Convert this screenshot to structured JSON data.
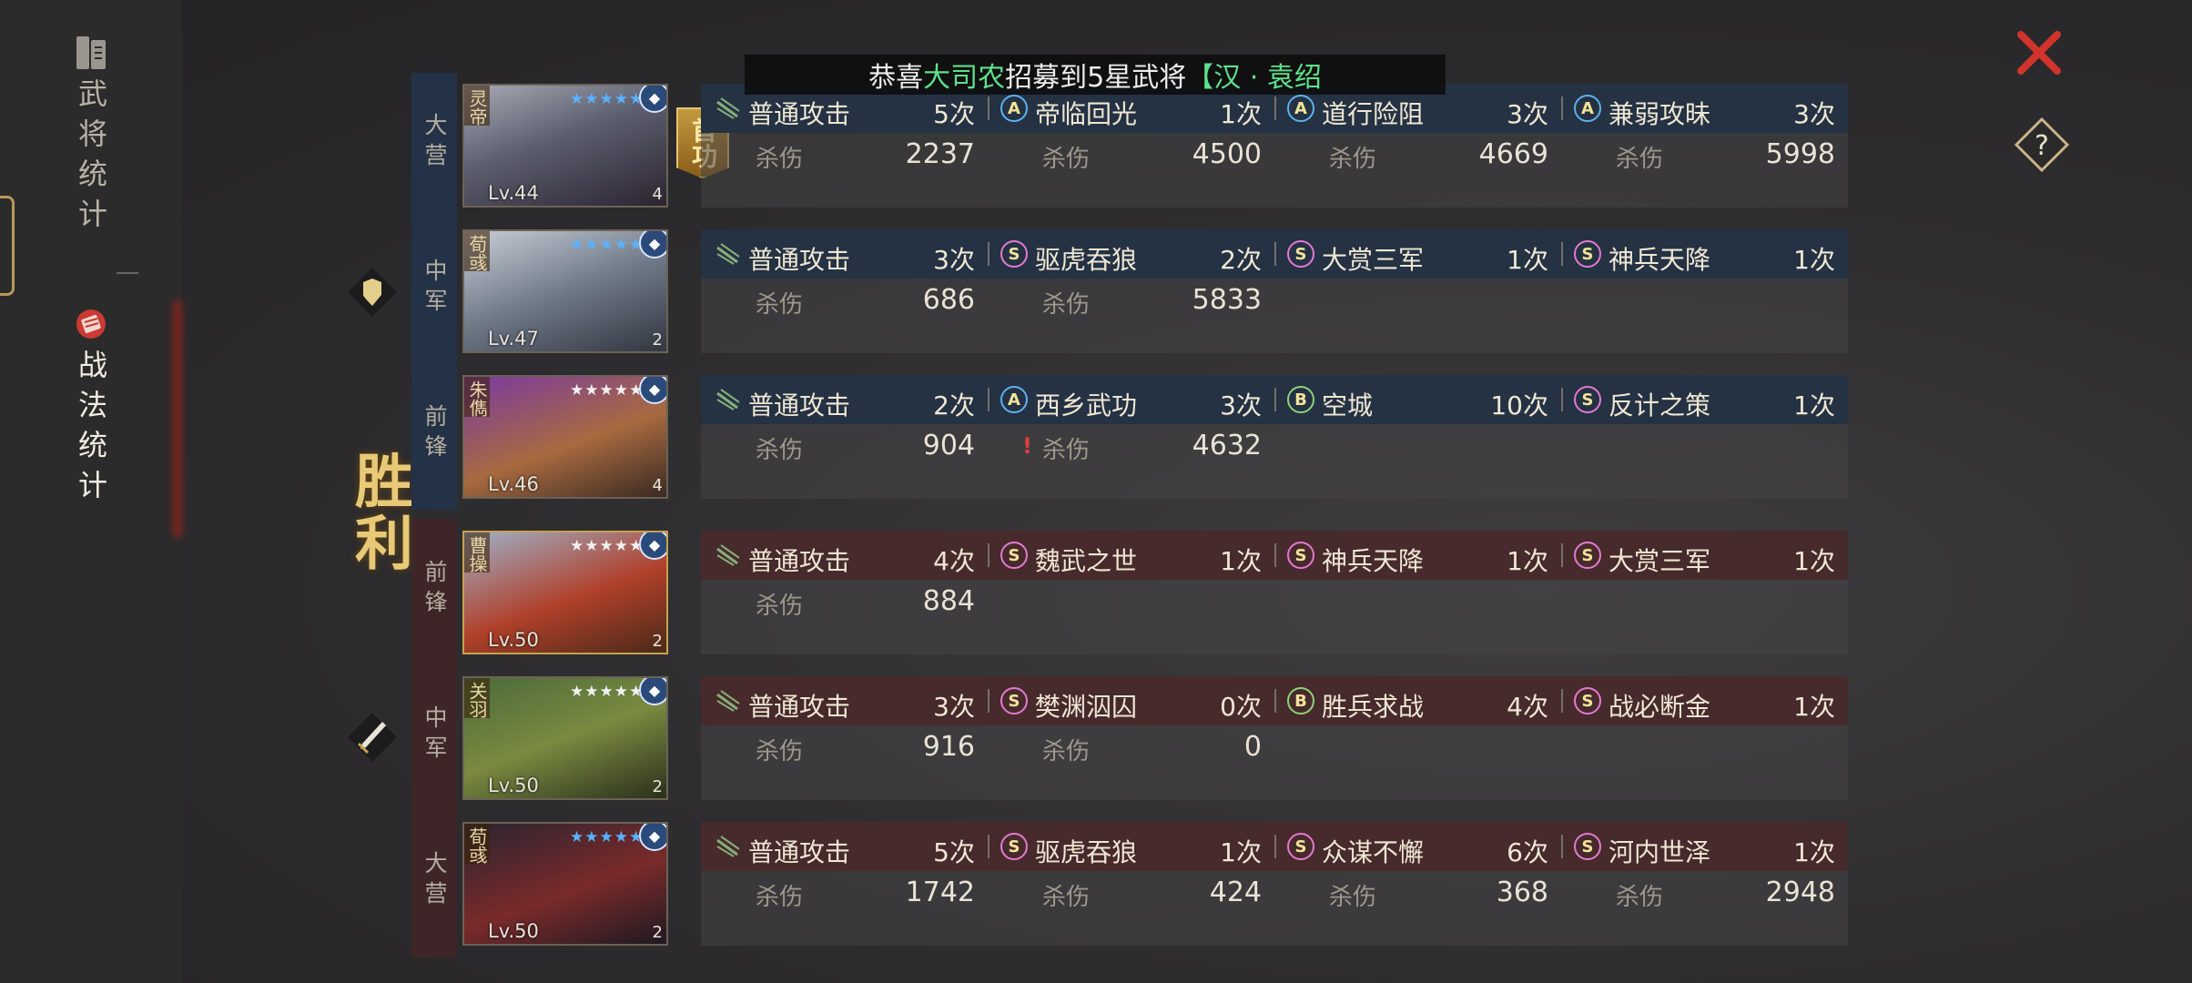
{
  "banner": {
    "prefix": "恭喜",
    "highlight1": "大司农",
    "middle": "招募到5星武将",
    "highlight2": "【汉 · 袁绍"
  },
  "sidebar": {
    "tabs": [
      {
        "label": "武将统计",
        "active": false
      },
      {
        "label": "战法统计",
        "active": true
      }
    ]
  },
  "result_text": "胜利",
  "mvp_badge": "首功",
  "colors": {
    "ally_band": "#233246",
    "enemy_band": "#3e2628",
    "highlight": "#5ee18a",
    "accent_red": "#d0342c"
  },
  "damage_label": "杀伤",
  "teams": [
    {
      "side": "ally",
      "rows": [
        {
          "position": "大营",
          "general": {
            "name": "灵帝",
            "level": "Lv.44",
            "awakening": "4",
            "star_color": "blue",
            "mvp": true
          },
          "skills": [
            {
              "grade": "N",
              "name": "普通攻击",
              "count": "5次",
              "damage": "2237"
            },
            {
              "grade": "A",
              "name": "帝临回光",
              "count": "1次",
              "damage": "4500"
            },
            {
              "grade": "A",
              "name": "道行险阻",
              "count": "3次",
              "damage": "4669"
            },
            {
              "grade": "A",
              "name": "兼弱攻昧",
              "count": "3次",
              "damage": "5998"
            }
          ]
        },
        {
          "position": "中军",
          "general": {
            "name": "荀彧",
            "level": "Lv.47",
            "awakening": "2",
            "star_color": "blue",
            "mvp": false
          },
          "skills": [
            {
              "grade": "N",
              "name": "普通攻击",
              "count": "3次",
              "damage": "686"
            },
            {
              "grade": "S",
              "name": "驱虎吞狼",
              "count": "2次",
              "damage": "5833"
            },
            {
              "grade": "S",
              "name": "大赏三军",
              "count": "1次",
              "damage": null
            },
            {
              "grade": "S",
              "name": "神兵天降",
              "count": "1次",
              "damage": null
            }
          ]
        },
        {
          "position": "前锋",
          "general": {
            "name": "朱儁",
            "level": "Lv.46",
            "awakening": "4",
            "star_color": "white",
            "mvp": false
          },
          "skills": [
            {
              "grade": "N",
              "name": "普通攻击",
              "count": "2次",
              "damage": "904"
            },
            {
              "grade": "A",
              "name": "西乡武功",
              "count": "3次",
              "damage": "4632",
              "warn": true
            },
            {
              "grade": "B",
              "name": "空城",
              "count": "10次",
              "damage": null
            },
            {
              "grade": "S",
              "name": "反计之策",
              "count": "1次",
              "damage": null
            }
          ]
        }
      ]
    },
    {
      "side": "enemy",
      "rows": [
        {
          "position": "前锋",
          "general": {
            "name": "曹操",
            "level": "Lv.50",
            "awakening": "2",
            "star_color": "white",
            "mvp": false
          },
          "skills": [
            {
              "grade": "N",
              "name": "普通攻击",
              "count": "4次",
              "damage": "884"
            },
            {
              "grade": "S",
              "name": "魏武之世",
              "count": "1次",
              "damage": null
            },
            {
              "grade": "S",
              "name": "神兵天降",
              "count": "1次",
              "damage": null
            },
            {
              "grade": "S",
              "name": "大赏三军",
              "count": "1次",
              "damage": null
            }
          ]
        },
        {
          "position": "中军",
          "general": {
            "name": "关羽",
            "level": "Lv.50",
            "awakening": "2",
            "star_color": "white",
            "mvp": false
          },
          "skills": [
            {
              "grade": "N",
              "name": "普通攻击",
              "count": "3次",
              "damage": "916"
            },
            {
              "grade": "S",
              "name": "樊渊泅囚",
              "count": "0次",
              "damage": "0"
            },
            {
              "grade": "B",
              "name": "胜兵求战",
              "count": "4次",
              "damage": null
            },
            {
              "grade": "S",
              "name": "战必断金",
              "count": "1次",
              "damage": null
            }
          ]
        },
        {
          "position": "大营",
          "general": {
            "name": "荀彧",
            "level": "Lv.50",
            "awakening": "2",
            "star_color": "blue",
            "mvp": false
          },
          "skills": [
            {
              "grade": "N",
              "name": "普通攻击",
              "count": "5次",
              "damage": "1742"
            },
            {
              "grade": "S",
              "name": "驱虎吞狼",
              "count": "1次",
              "damage": "424"
            },
            {
              "grade": "S",
              "name": "众谋不懈",
              "count": "6次",
              "damage": "368"
            },
            {
              "grade": "S",
              "name": "河内世泽",
              "count": "1次",
              "damage": "2948"
            }
          ]
        }
      ]
    }
  ]
}
